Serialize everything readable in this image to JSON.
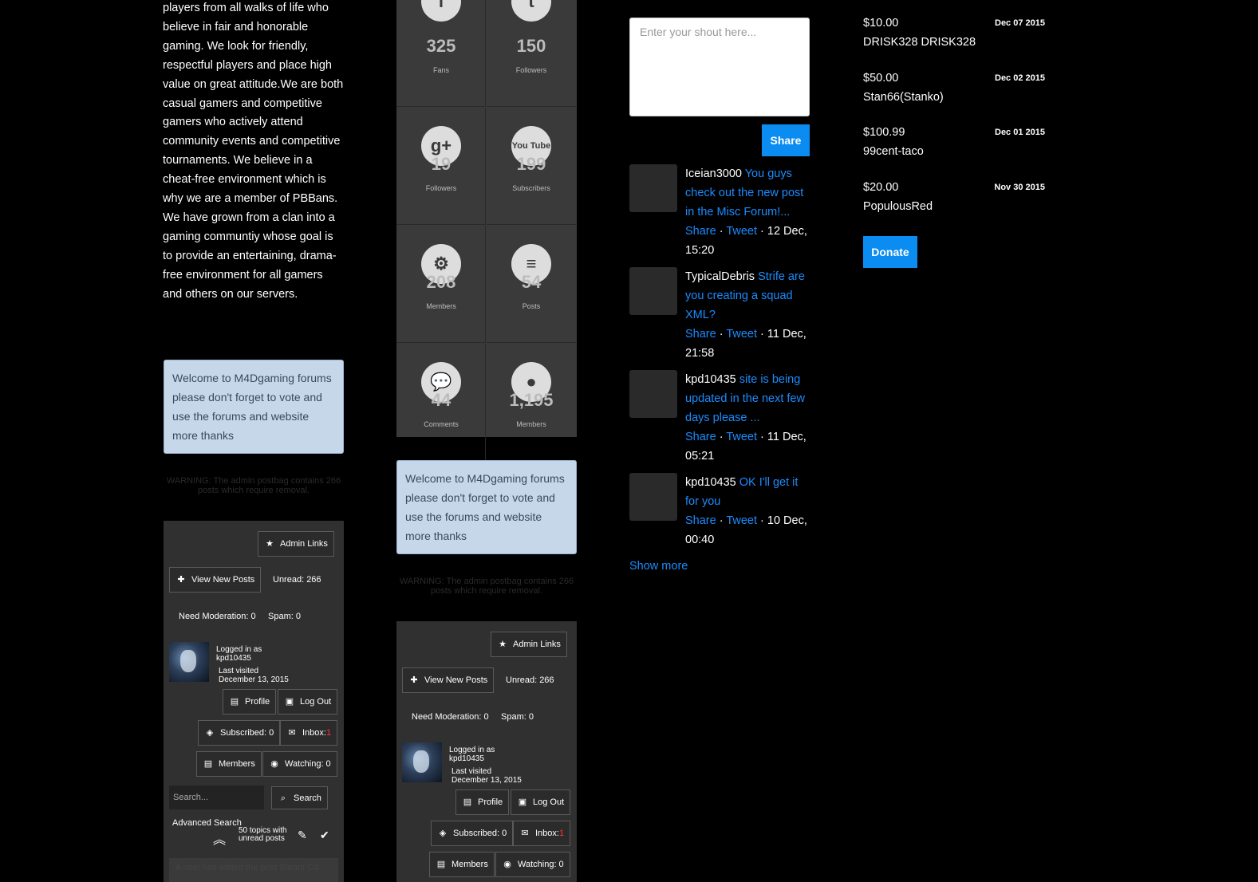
{
  "about": {
    "text": "players from all walks of life who believe in fair and honorable gaming. We look for friendly, respectful players and place high value on great attitude.We are both casual gamers and competitive gamers who actively attend community events and competitive tournaments. We believe in a cheat-free environment which is why we are a member of PBBans. We have grown from a clan into a gaming communtiy whose goal is to provide an entertaining, drama-free environment for all gamers and others on our servers."
  },
  "notice": {
    "welcome": "Welcome to M4Dgaming forums please don't forget to vote and use the forums and website more thanks",
    "warning": "WARNING: The admin postbag contains 266 posts which require removal."
  },
  "admin_panel": {
    "admin_links": "Admin Links",
    "view_new_posts": "View New Posts",
    "unread": "Unread: 266",
    "need_moderation": "Need Moderation: 0",
    "spam": "Spam: 0",
    "logged_in_as": "Logged in as",
    "username": "kpd10435",
    "last_visited": "Last visited",
    "last_visited_date": "December 13, 2015",
    "profile": "Profile",
    "log_out": "Log Out",
    "subscribed": "Subscribed: 0",
    "inbox": "Inbox: ",
    "inbox_count": "1",
    "members": "Members",
    "watching": "Watching: 0",
    "search_placeholder": "Search...",
    "search_button": "Search",
    "advanced_search": "Advanced Search",
    "topics_unread": "50 topics with unread posts",
    "edited_notice": "A user has edited the post Steam Cd"
  },
  "stats": [
    {
      "icon": "facebook-icon",
      "glyph": "f",
      "value": "325",
      "label": "Fans"
    },
    {
      "icon": "twitter-icon",
      "glyph": "t",
      "value": "150",
      "label": "Followers"
    },
    {
      "icon": "google-plus-icon",
      "glyph": "g+",
      "value": "19",
      "label": "Followers"
    },
    {
      "icon": "youtube-icon",
      "glyph": "You Tube",
      "value": "199",
      "label": "Subscribers"
    },
    {
      "icon": "steam-icon",
      "glyph": "⚙",
      "value": "208",
      "label": "Members"
    },
    {
      "icon": "document-icon",
      "glyph": "≡",
      "value": "54",
      "label": "Posts"
    },
    {
      "icon": "comments-icon",
      "glyph": "💬",
      "value": "44",
      "label": "Comments"
    },
    {
      "icon": "user-icon",
      "glyph": "●",
      "value": "1,195",
      "label": "Members"
    }
  ],
  "shoutbox": {
    "placeholder": "Enter your shout here...",
    "share_button": "Share",
    "show_more": "Show more",
    "shouts": [
      {
        "user": "Iceian3000",
        "message": "You guys check out the new post in the Misc Forum!...",
        "share": "Share",
        "tweet": "Tweet",
        "time": "12 Dec, 15:20"
      },
      {
        "user": "TypicalDebris",
        "message": "Strife are you creating a squad XML?",
        "share": "Share",
        "tweet": "Tweet",
        "time": "11 Dec, 21:58"
      },
      {
        "user": "kpd10435",
        "message": "site is being updated in the next few days please ...",
        "share": "Share",
        "tweet": "Tweet",
        "time": "11 Dec, 05:21"
      },
      {
        "user": "kpd10435",
        "message": "OK I'll get it for you",
        "share": "Share",
        "tweet": "Tweet",
        "time": "10 Dec, 00:40"
      }
    ]
  },
  "donations": {
    "items": [
      {
        "amount": "$10.00",
        "date": "Dec 07 2015",
        "donor": "DRISK328 DRISK328"
      },
      {
        "amount": "$50.00",
        "date": "Dec 02 2015",
        "donor": "Stan66(Stanko)"
      },
      {
        "amount": "$100.99",
        "date": "Dec 01 2015",
        "donor": "99cent-taco"
      },
      {
        "amount": "$20.00",
        "date": "Nov 30 2015",
        "donor": "PopulousRed"
      }
    ],
    "donate_button": "Donate"
  },
  "colors": {
    "accent": "#0a8cf0",
    "link": "#1a8cff",
    "notice_bg": "#c7d7ea",
    "panel_bg": "#303030",
    "inbox_count": "#ff3333"
  }
}
